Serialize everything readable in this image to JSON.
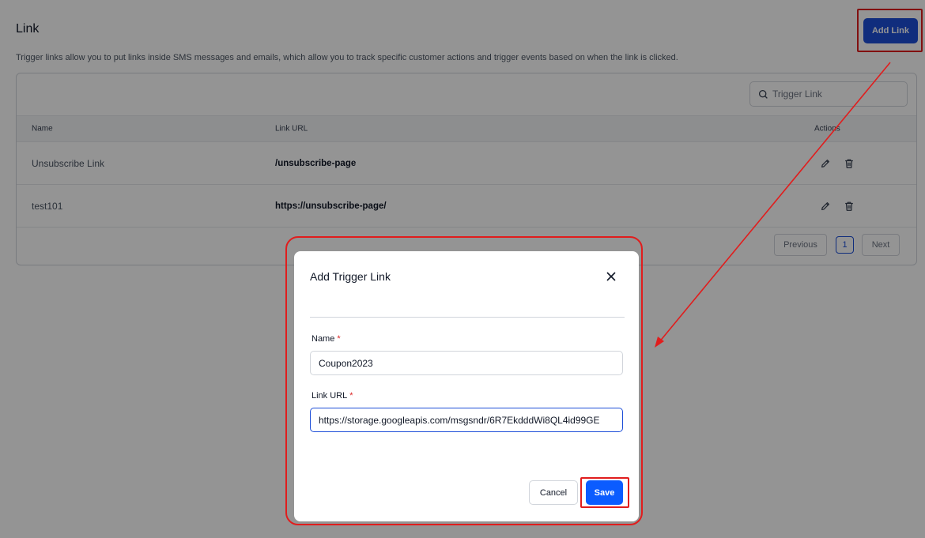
{
  "header": {
    "title": "Link",
    "description": "Trigger links allow you to put links inside SMS messages and emails, which allow you to track specific customer actions and trigger events based on when the link is clicked.",
    "add_button": "Add Link"
  },
  "search": {
    "placeholder": "Trigger Link"
  },
  "table": {
    "columns": [
      "Name",
      "Link URL",
      "Actions"
    ],
    "rows": [
      {
        "name": "Unsubscribe Link",
        "url": "/unsubscribe-page"
      },
      {
        "name": "test101",
        "url": "https://unsubscribe-page/"
      }
    ]
  },
  "pagination": {
    "previous": "Previous",
    "current": "1",
    "next": "Next"
  },
  "modal": {
    "title": "Add Trigger Link",
    "name_label": "Name",
    "name_value": "Coupon2023",
    "url_label": "Link URL",
    "url_value": "https://storage.googleapis.com/msgsndr/6R7EkdddWi8QL4id99GE",
    "required_mark": "*",
    "cancel": "Cancel",
    "save": "Save"
  },
  "colors": {
    "primary": "#1d4ed8",
    "save": "#0b5cff",
    "annotation": "#e11d1d",
    "required": "#dc2626"
  },
  "icons": {
    "search": "search-icon",
    "edit": "pencil-icon",
    "delete": "trash-icon",
    "close": "close-icon"
  }
}
